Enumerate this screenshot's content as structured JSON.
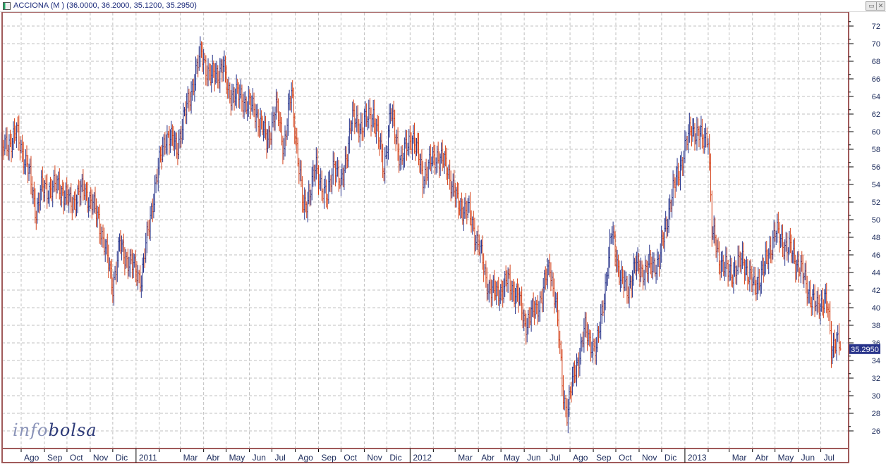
{
  "window": {
    "title": "ACCIONA (M ) (36.0000, 36.2000, 35.1200, 35.2950)",
    "restore_icon": "restore-icon",
    "close_icon": "close-icon"
  },
  "logo": {
    "part1": "info",
    "part2": "bolsa"
  },
  "colors": {
    "up": "#27338a",
    "down": "#d4421a",
    "frame": "#a05a5a",
    "grid": "#c0c0c0",
    "last_price_bg": "#27338a"
  },
  "chart_data": {
    "type": "ohlc",
    "title": "ACCIONA (M )",
    "last_ohlc": {
      "open": 36.0,
      "high": 36.2,
      "low": 35.12,
      "close": 35.295
    },
    "last_price_label": "35.2950",
    "y_axis": {
      "position": "right",
      "ylim": [
        24,
        73
      ],
      "ticks": [
        26,
        28,
        30,
        32,
        34,
        36,
        38,
        40,
        42,
        44,
        46,
        48,
        50,
        52,
        54,
        56,
        58,
        60,
        62,
        64,
        66,
        68,
        70,
        72
      ]
    },
    "grid": true,
    "x_ticks": [
      {
        "date": "2010-08-01",
        "label": "Ago"
      },
      {
        "date": "2010-09-01",
        "label": "Sep"
      },
      {
        "date": "2010-10-01",
        "label": "Oct"
      },
      {
        "date": "2010-11-01",
        "label": "Nov"
      },
      {
        "date": "2010-12-01",
        "label": "Dic"
      },
      {
        "date": "2011-01-01",
        "label": "2011",
        "year": true
      },
      {
        "date": "2011-02-01",
        "label": ""
      },
      {
        "date": "2011-03-01",
        "label": "Mar"
      },
      {
        "date": "2011-04-01",
        "label": "Abr"
      },
      {
        "date": "2011-05-01",
        "label": "May"
      },
      {
        "date": "2011-06-01",
        "label": "Jun"
      },
      {
        "date": "2011-07-01",
        "label": "Jul"
      },
      {
        "date": "2011-08-01",
        "label": "Ago"
      },
      {
        "date": "2011-09-01",
        "label": "Sep"
      },
      {
        "date": "2011-10-01",
        "label": "Oct"
      },
      {
        "date": "2011-11-01",
        "label": "Nov"
      },
      {
        "date": "2011-12-01",
        "label": "Dic"
      },
      {
        "date": "2012-01-01",
        "label": "2012",
        "year": true
      },
      {
        "date": "2012-02-01",
        "label": ""
      },
      {
        "date": "2012-03-01",
        "label": "Mar"
      },
      {
        "date": "2012-04-01",
        "label": "Abr"
      },
      {
        "date": "2012-05-01",
        "label": "May"
      },
      {
        "date": "2012-06-01",
        "label": "Jun"
      },
      {
        "date": "2012-07-01",
        "label": "Jul"
      },
      {
        "date": "2012-08-01",
        "label": "Ago"
      },
      {
        "date": "2012-09-01",
        "label": "Sep"
      },
      {
        "date": "2012-10-01",
        "label": "Oct"
      },
      {
        "date": "2012-11-01",
        "label": "Nov"
      },
      {
        "date": "2012-12-01",
        "label": "Dic"
      },
      {
        "date": "2013-01-01",
        "label": "2013",
        "year": true
      },
      {
        "date": "2013-02-01",
        "label": ""
      },
      {
        "date": "2013-03-01",
        "label": "Mar"
      },
      {
        "date": "2013-04-01",
        "label": "Abr"
      },
      {
        "date": "2013-05-01",
        "label": "May"
      },
      {
        "date": "2013-06-01",
        "label": "Jun"
      },
      {
        "date": "2013-07-01",
        "label": "Jul"
      }
    ],
    "close_series": [
      [
        "2010-07-06",
        57.8
      ],
      [
        "2010-07-26",
        59.8
      ],
      [
        "2010-08-10",
        55.8
      ],
      [
        "2010-08-21",
        51.0
      ],
      [
        "2010-08-28",
        53.4
      ],
      [
        "2010-09-21",
        53.8
      ],
      [
        "2010-10-05",
        51.8
      ],
      [
        "2010-10-24",
        53.5
      ],
      [
        "2010-11-12",
        50.2
      ],
      [
        "2010-11-21",
        46.6
      ],
      [
        "2010-12-01",
        42.6
      ],
      [
        "2010-12-10",
        47.0
      ],
      [
        "2010-12-24",
        45.0
      ],
      [
        "2011-01-08",
        43.4
      ],
      [
        "2011-01-17",
        48.6
      ],
      [
        "2011-01-26",
        53.8
      ],
      [
        "2011-02-10",
        59.8
      ],
      [
        "2011-02-24",
        58.2
      ],
      [
        "2011-03-08",
        62.2
      ],
      [
        "2011-03-20",
        66.2
      ],
      [
        "2011-03-29",
        69.0
      ],
      [
        "2011-04-10",
        66.0
      ],
      [
        "2011-04-27",
        67.4
      ],
      [
        "2011-05-03",
        64.6
      ],
      [
        "2011-05-22",
        63.8
      ],
      [
        "2011-06-10",
        62.2
      ],
      [
        "2011-06-24",
        59.0
      ],
      [
        "2011-07-08",
        62.6
      ],
      [
        "2011-07-17",
        58.2
      ],
      [
        "2011-07-27",
        64.6
      ],
      [
        "2011-08-06",
        55.8
      ],
      [
        "2011-08-12",
        51.0
      ],
      [
        "2011-08-29",
        55.8
      ],
      [
        "2011-09-13",
        52.2
      ],
      [
        "2011-09-22",
        57.0
      ],
      [
        "2011-10-01",
        53.4
      ],
      [
        "2011-10-15",
        61.4
      ],
      [
        "2011-10-29",
        60.6
      ],
      [
        "2011-11-13",
        62.2
      ],
      [
        "2011-11-27",
        55.8
      ],
      [
        "2011-12-06",
        62.2
      ],
      [
        "2011-12-20",
        56.6
      ],
      [
        "2012-01-04",
        59.8
      ],
      [
        "2012-01-18",
        55.0
      ],
      [
        "2012-02-06",
        57.4
      ],
      [
        "2012-02-20",
        55.8
      ],
      [
        "2012-03-04",
        51.8
      ],
      [
        "2012-03-18",
        51.0
      ],
      [
        "2012-04-02",
        47.0
      ],
      [
        "2012-04-11",
        43.0
      ],
      [
        "2012-04-25",
        41.4
      ],
      [
        "2012-05-09",
        43.0
      ],
      [
        "2012-05-23",
        41.4
      ],
      [
        "2012-06-02",
        38.2
      ],
      [
        "2012-06-16",
        39.8
      ],
      [
        "2012-06-25",
        41.4
      ],
      [
        "2012-07-05",
        45.0
      ],
      [
        "2012-07-14",
        39.8
      ],
      [
        "2012-07-23",
        30.2
      ],
      [
        "2012-07-28",
        28.2
      ],
      [
        "2012-08-07",
        32.6
      ],
      [
        "2012-08-21",
        37.4
      ],
      [
        "2012-09-05",
        35.0
      ],
      [
        "2012-09-14",
        40.6
      ],
      [
        "2012-09-26",
        48.6
      ],
      [
        "2012-10-07",
        43.4
      ],
      [
        "2012-10-16",
        41.8
      ],
      [
        "2012-10-26",
        44.6
      ],
      [
        "2012-11-09",
        44.2
      ],
      [
        "2012-11-28",
        45.4
      ],
      [
        "2012-12-12",
        51.8
      ],
      [
        "2012-12-26",
        56.2
      ],
      [
        "2013-01-10",
        60.6
      ],
      [
        "2013-01-24",
        59.0
      ],
      [
        "2013-02-01",
        59.8
      ],
      [
        "2013-02-06",
        48.6
      ],
      [
        "2013-02-17",
        45.4
      ],
      [
        "2013-03-01",
        43.8
      ],
      [
        "2013-03-20",
        45.4
      ],
      [
        "2013-04-03",
        42.2
      ],
      [
        "2013-04-17",
        44.6
      ],
      [
        "2013-05-01",
        48.6
      ],
      [
        "2013-05-20",
        46.6
      ],
      [
        "2013-06-03",
        44.6
      ],
      [
        "2013-06-17",
        41.4
      ],
      [
        "2013-06-26",
        39.8
      ],
      [
        "2013-07-06",
        41.4
      ],
      [
        "2013-07-10",
        39.8
      ],
      [
        "2013-07-15",
        35.0
      ],
      [
        "2013-07-22",
        37.0
      ],
      [
        "2013-07-27",
        35.295
      ]
    ]
  }
}
